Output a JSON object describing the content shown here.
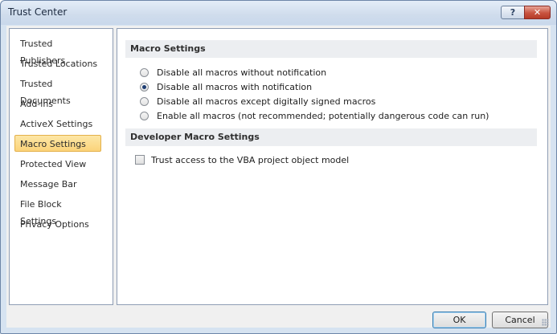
{
  "window": {
    "title": "Trust Center"
  },
  "title_buttons": {
    "help_glyph": "?",
    "close_glyph": "✕"
  },
  "nav": {
    "items": [
      {
        "label": "Trusted Publishers"
      },
      {
        "label": "Trusted Locations"
      },
      {
        "label": "Trusted Documents"
      },
      {
        "label": "Add-ins"
      },
      {
        "label": "ActiveX Settings"
      },
      {
        "label": "Macro Settings",
        "selected": true
      },
      {
        "label": "Protected View"
      },
      {
        "label": "Message Bar"
      },
      {
        "label": "File Block Settings"
      },
      {
        "label": "Privacy Options"
      }
    ]
  },
  "macro_settings": {
    "header": "Macro Settings",
    "options": [
      {
        "label": "Disable all macros without notification",
        "checked": false
      },
      {
        "label": "Disable all macros with notification",
        "checked": true
      },
      {
        "label": "Disable all macros except digitally signed macros",
        "checked": false
      },
      {
        "label": "Enable all macros (not recommended; potentially dangerous code can run)",
        "checked": false
      }
    ]
  },
  "developer_settings": {
    "header": "Developer Macro Settings",
    "trust_vba": {
      "label": "Trust access to the VBA project object model",
      "checked": false
    }
  },
  "footer": {
    "ok_label": "OK",
    "cancel_label": "Cancel"
  },
  "colors": {
    "selected_nav": "#fbd37a",
    "close_button": "#c8533f",
    "radio_dot": "#1d3d73"
  }
}
